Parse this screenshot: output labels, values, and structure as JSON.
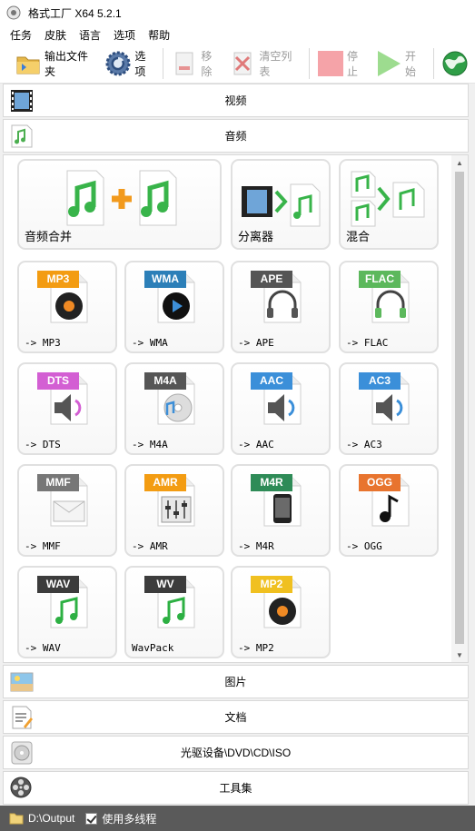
{
  "window": {
    "title": "格式工厂 X64 5.2.1"
  },
  "menu": {
    "items": [
      "任务",
      "皮肤",
      "语言",
      "选项",
      "帮助"
    ]
  },
  "toolbar": {
    "output_folder": "输出文件夹",
    "options": "选项",
    "remove": "移除",
    "clear_list": "清空列表",
    "stop": "停止",
    "start": "开始"
  },
  "categories": {
    "video": "视频",
    "audio": "音频",
    "image": "图片",
    "document": "文档",
    "disc": "光驱设备\\DVD\\CD\\ISO",
    "tools": "工具集"
  },
  "audio_tools": {
    "big": [
      {
        "label": "音频合并",
        "icon": "audio-merge-icon"
      },
      {
        "label": "分离器",
        "icon": "splitter-icon"
      },
      {
        "label": "混合",
        "icon": "mix-icon"
      }
    ],
    "formats": [
      {
        "badge": "MP3",
        "label": "-> MP3",
        "color": "#f39c12",
        "icon": "record-icon"
      },
      {
        "badge": "WMA",
        "label": "-> WMA",
        "color": "#2c7fb8",
        "icon": "media-disc-icon"
      },
      {
        "badge": "APE",
        "label": "-> APE",
        "color": "#555555",
        "icon": "headphones-icon"
      },
      {
        "badge": "FLAC",
        "label": "-> FLAC",
        "color": "#5cb85c",
        "icon": "headphones-icon"
      },
      {
        "badge": "DTS",
        "label": "-> DTS",
        "color": "#d35fd3",
        "icon": "speaker-icon"
      },
      {
        "badge": "M4A",
        "label": "-> M4A",
        "color": "#555555",
        "icon": "cd-music-icon"
      },
      {
        "badge": "AAC",
        "label": "-> AAC",
        "color": "#3b8fd9",
        "icon": "speaker-icon"
      },
      {
        "badge": "AC3",
        "label": "-> AC3",
        "color": "#3b8fd9",
        "icon": "speaker-icon"
      },
      {
        "badge": "MMF",
        "label": "-> MMF",
        "color": "#777777",
        "icon": "envelope-icon"
      },
      {
        "badge": "AMR",
        "label": "-> AMR",
        "color": "#f39c12",
        "icon": "mixer-icon"
      },
      {
        "badge": "M4R",
        "label": "-> M4R",
        "color": "#2e8b57",
        "icon": "phone-icon"
      },
      {
        "badge": "OGG",
        "label": "-> OGG",
        "color": "#e8742e",
        "icon": "music-note-icon"
      },
      {
        "badge": "WAV",
        "label": "-> WAV",
        "color": "#3c3c3c",
        "icon": "music-notes-icon"
      },
      {
        "badge": "WV",
        "label": "WavPack",
        "color": "#3c3c3c",
        "icon": "music-notes-icon"
      },
      {
        "badge": "MP2",
        "label": "-> MP2",
        "color": "#f0c020",
        "icon": "record-icon"
      }
    ]
  },
  "status": {
    "output_path": "D:\\Output",
    "multithread_label": "使用多线程"
  }
}
